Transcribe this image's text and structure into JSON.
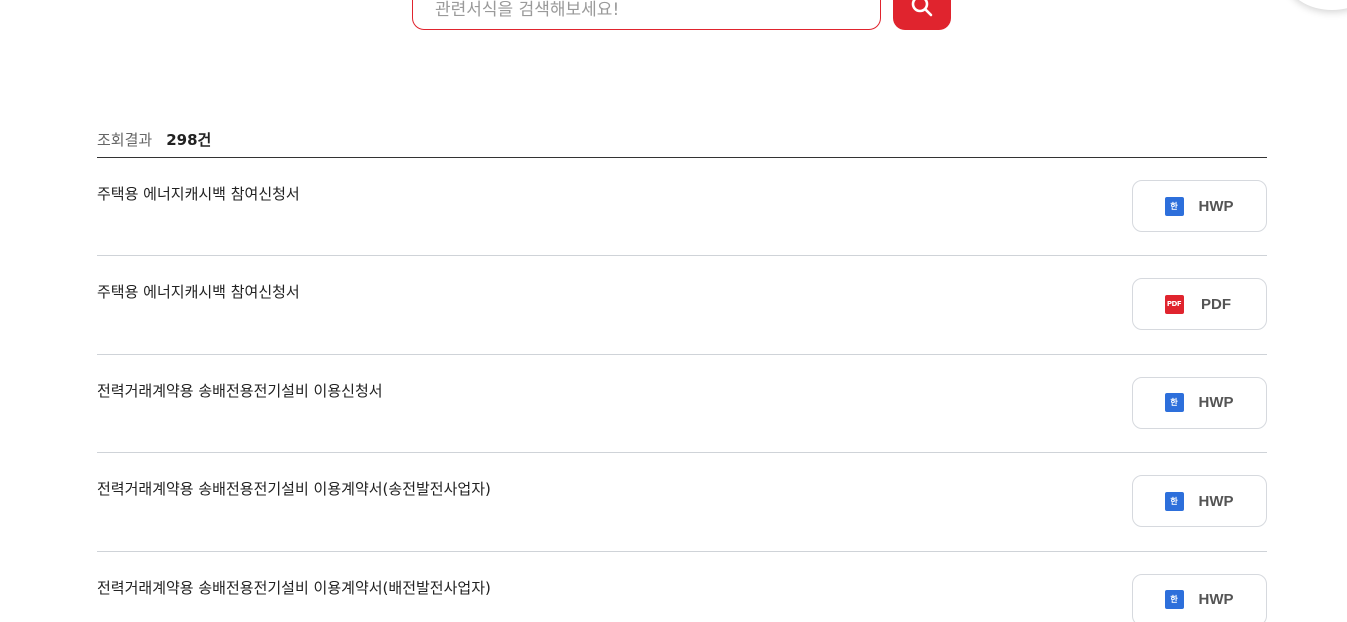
{
  "search": {
    "placeholder": "관련서식을 검색해보세요!",
    "button_icon": "search-icon"
  },
  "results": {
    "label": "조회결과",
    "count": "298건",
    "items": [
      {
        "title": "주택용 에너지캐시백 참여신청서",
        "file_type": "HWP",
        "icon_text": "한",
        "icon_color": "#2d6fdb"
      },
      {
        "title": "주택용 에너지캐시백 참여신청서",
        "file_type": "PDF",
        "icon_text": "PDF",
        "icon_color": "#e0242e"
      },
      {
        "title": "전력거래계약용 송배전용전기설비 이용신청서",
        "file_type": "HWP",
        "icon_text": "한",
        "icon_color": "#2d6fdb"
      },
      {
        "title": "전력거래계약용 송배전용전기설비 이용계약서(송전발전사업자)",
        "file_type": "HWP",
        "icon_text": "한",
        "icon_color": "#2d6fdb"
      },
      {
        "title": "전력거래계약용 송배전용전기설비 이용계약서(배전발전사업자)",
        "file_type": "HWP",
        "icon_text": "한",
        "icon_color": "#2d6fdb"
      }
    ]
  },
  "colors": {
    "accent": "#e0242e",
    "hwp": "#2d6fdb"
  }
}
